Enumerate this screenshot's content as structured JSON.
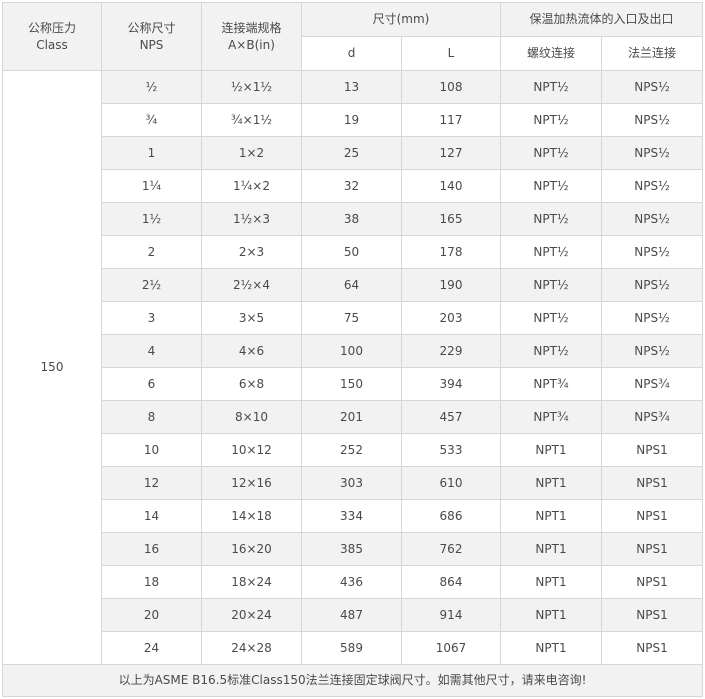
{
  "header": {
    "class": [
      "公称压力",
      "Class"
    ],
    "nps": [
      "公称尺寸",
      "NPS"
    ],
    "spec": [
      "连接端规格",
      "A×B(in)"
    ],
    "dims": "尺寸(mm)",
    "dims_sub": [
      "d",
      "L"
    ],
    "heating": "保温加热流体的入口及出口",
    "heating_sub": [
      "螺纹连接",
      "法兰连接"
    ]
  },
  "class_value": "150",
  "rows": [
    {
      "nps": "½",
      "spec": "½×1½",
      "d": "13",
      "L": "108",
      "thread": "NPT½",
      "flange": "NPS½"
    },
    {
      "nps": "¾",
      "spec": "¾×1½",
      "d": "19",
      "L": "117",
      "thread": "NPT½",
      "flange": "NPS½"
    },
    {
      "nps": "1",
      "spec": "1×2",
      "d": "25",
      "L": "127",
      "thread": "NPT½",
      "flange": "NPS½"
    },
    {
      "nps": "1¼",
      "spec": "1¼×2",
      "d": "32",
      "L": "140",
      "thread": "NPT½",
      "flange": "NPS½"
    },
    {
      "nps": "1½",
      "spec": "1½×3",
      "d": "38",
      "L": "165",
      "thread": "NPT½",
      "flange": "NPS½"
    },
    {
      "nps": "2",
      "spec": "2×3",
      "d": "50",
      "L": "178",
      "thread": "NPT½",
      "flange": "NPS½"
    },
    {
      "nps": "2½",
      "spec": "2½×4",
      "d": "64",
      "L": "190",
      "thread": "NPT½",
      "flange": "NPS½"
    },
    {
      "nps": "3",
      "spec": "3×5",
      "d": "75",
      "L": "203",
      "thread": "NPT½",
      "flange": "NPS½"
    },
    {
      "nps": "4",
      "spec": "4×6",
      "d": "100",
      "L": "229",
      "thread": "NPT½",
      "flange": "NPS½"
    },
    {
      "nps": "6",
      "spec": "6×8",
      "d": "150",
      "L": "394",
      "thread": "NPT¾",
      "flange": "NPS¾"
    },
    {
      "nps": "8",
      "spec": "8×10",
      "d": "201",
      "L": "457",
      "thread": "NPT¾",
      "flange": "NPS¾"
    },
    {
      "nps": "10",
      "spec": "10×12",
      "d": "252",
      "L": "533",
      "thread": "NPT1",
      "flange": "NPS1"
    },
    {
      "nps": "12",
      "spec": "12×16",
      "d": "303",
      "L": "610",
      "thread": "NPT1",
      "flange": "NPS1"
    },
    {
      "nps": "14",
      "spec": "14×18",
      "d": "334",
      "L": "686",
      "thread": "NPT1",
      "flange": "NPS1"
    },
    {
      "nps": "16",
      "spec": "16×20",
      "d": "385",
      "L": "762",
      "thread": "NPT1",
      "flange": "NPS1"
    },
    {
      "nps": "18",
      "spec": "18×24",
      "d": "436",
      "L": "864",
      "thread": "NPT1",
      "flange": "NPS1"
    },
    {
      "nps": "20",
      "spec": "20×24",
      "d": "487",
      "L": "914",
      "thread": "NPT1",
      "flange": "NPS1"
    },
    {
      "nps": "24",
      "spec": "24×28",
      "d": "589",
      "L": "1067",
      "thread": "NPT1",
      "flange": "NPS1"
    }
  ],
  "footer_note": "以上为ASME B16.5标准Class150法兰连接固定球阀尺寸。如需其他尺寸，请来电咨询!",
  "colors": {
    "header_bg": "#f2f2f2",
    "border": "#d7d7d7",
    "text": "#4a4a4a"
  }
}
